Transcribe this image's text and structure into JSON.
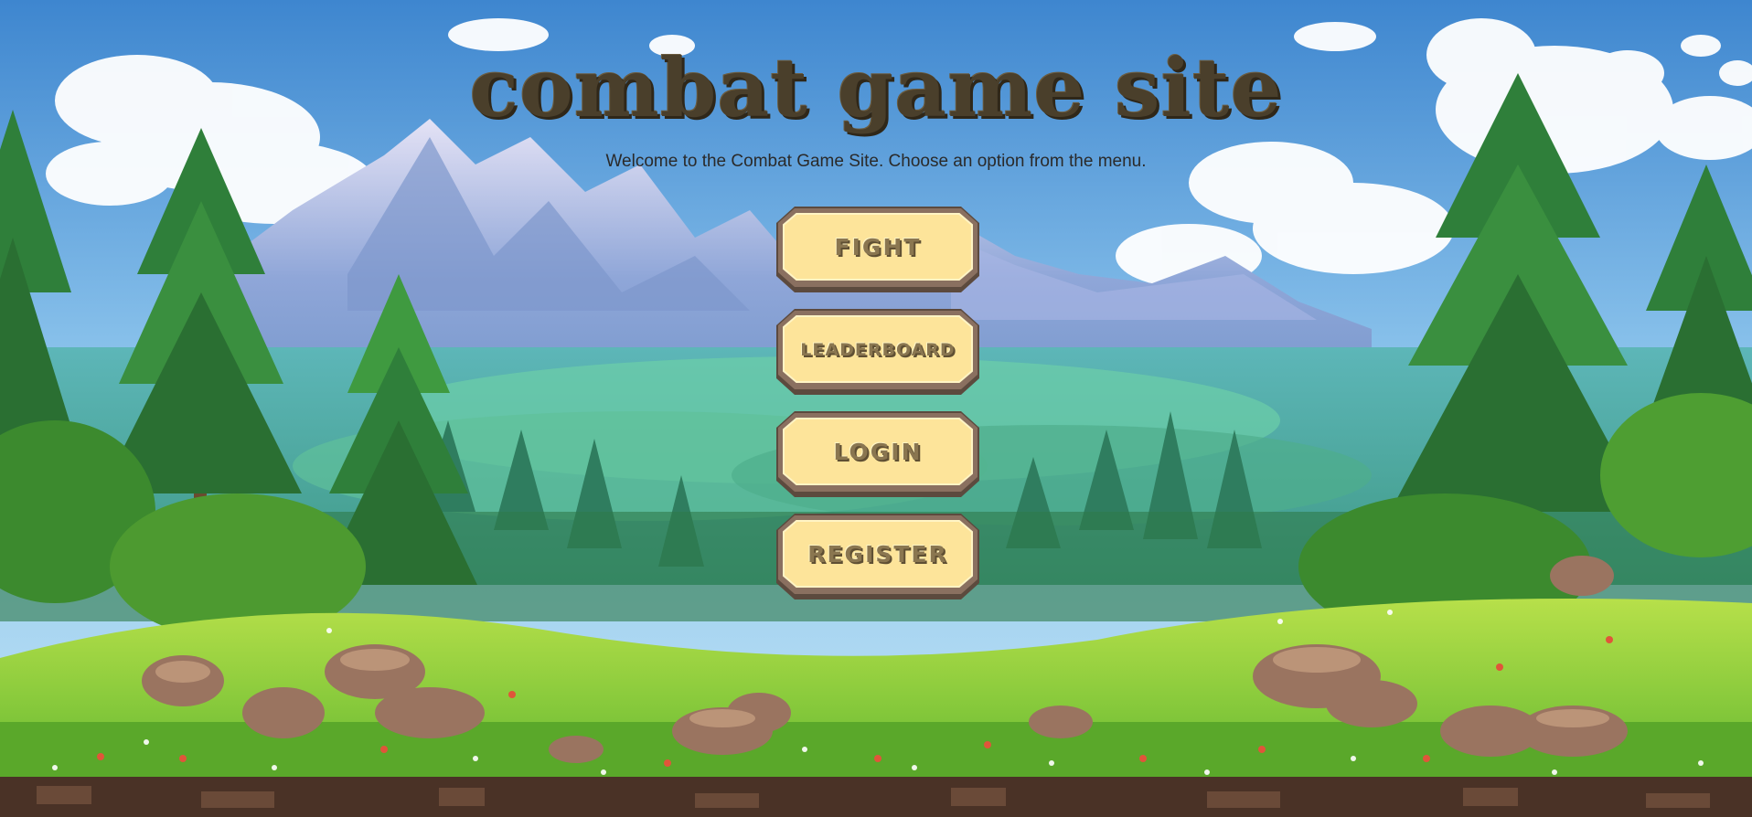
{
  "page": {
    "title": "combat game site",
    "subtitle": "Welcome to the Combat Game Site. Choose an option from the menu."
  },
  "menu": {
    "items": [
      {
        "label": "FIGHT"
      },
      {
        "label": "LEADERBOARD"
      },
      {
        "label": "LOGIN"
      },
      {
        "label": "REGISTER"
      }
    ]
  },
  "colors": {
    "button_fill": "#fde49a",
    "button_border": "#6f5a4a",
    "button_text": "#8a7650",
    "title_text": "#4a3f2b",
    "sky_top": "#4a8fd0",
    "grass": "#8fd040"
  }
}
